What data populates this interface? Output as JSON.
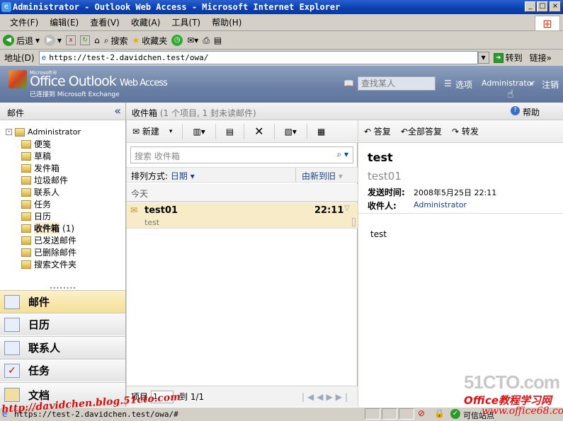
{
  "window": {
    "title": "Administrator - Outlook Web Access - Microsoft Internet Explorer"
  },
  "menu": [
    "文件(F)",
    "编辑(E)",
    "查看(V)",
    "收藏(A)",
    "工具(T)",
    "帮助(H)"
  ],
  "toolbar": {
    "back": "后退",
    "search": "搜索",
    "favorites": "收藏夹"
  },
  "address": {
    "label": "地址(D)",
    "url": "https://test-2.davidchen.test/owa/",
    "go": "转到",
    "links": "链接"
  },
  "owa": {
    "ms": "Microsoft®",
    "title": "Office Outlook",
    "title2": "Web Access",
    "connected": "已连接到 Microsoft Exchange",
    "find_placeholder": "查找某人",
    "options": "选项",
    "user": "Administrator",
    "logout": "注销",
    "help": "帮助"
  },
  "left": {
    "header": "邮件",
    "root": "Administrator",
    "folders": [
      {
        "name": "便笺"
      },
      {
        "name": "草稿"
      },
      {
        "name": "发件箱"
      },
      {
        "name": "垃圾邮件"
      },
      {
        "name": "联系人"
      },
      {
        "name": "任务"
      },
      {
        "name": "日历"
      },
      {
        "name": "收件箱",
        "count": "(1)"
      },
      {
        "name": "已发送邮件"
      },
      {
        "name": "已删除邮件"
      },
      {
        "name": "搜索文件夹"
      }
    ],
    "nav": [
      "邮件",
      "日历",
      "联系人",
      "任务",
      "文档"
    ]
  },
  "list": {
    "folder": "收件箱",
    "summary": "(1 个项目, 1 封未读邮件)",
    "new": "新建",
    "search_placeholder": "搜索 收件箱",
    "sort_label": "排列方式:",
    "sort_by": "日期",
    "order": "由新到旧",
    "group": "今天",
    "messages": [
      {
        "sender": "test01",
        "time": "22:11",
        "subject": "test"
      }
    ],
    "footer": {
      "item_label": "项目",
      "page": "1",
      "of": "到 1/1"
    }
  },
  "reading": {
    "reply": "答复",
    "reply_all": "全部答复",
    "forward": "转发",
    "subject": "test",
    "from": "test01",
    "sent_label": "发送时间:",
    "sent": "2008年5月25日 22:11",
    "to_label": "收件人:",
    "to": "Administrator",
    "body": "test"
  },
  "status": {
    "url": "https://test-2.davidchen.test/owa/#",
    "zone": "可信站点"
  },
  "watermarks": {
    "blog": "http://davidchen.blog.51cto.com",
    "site": "51CTO.com",
    "office": "Office教程学习网",
    "office_url": "www.office68.com"
  }
}
